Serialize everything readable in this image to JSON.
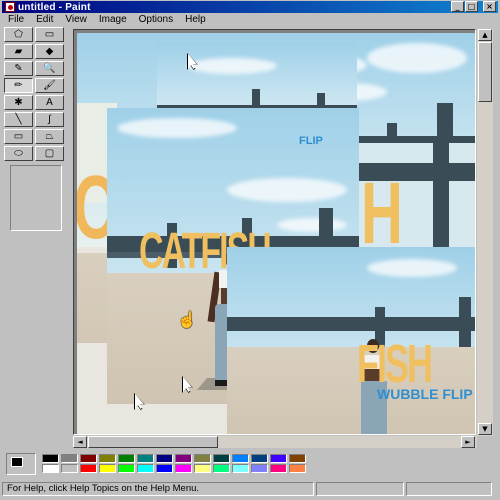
{
  "window": {
    "title": "untitled - Paint"
  },
  "title_buttons": {
    "minimize": "_",
    "maximize": "□",
    "close": "×"
  },
  "menu": {
    "items": [
      "File",
      "Edit",
      "View",
      "Image",
      "Options",
      "Help"
    ]
  },
  "toolbox": {
    "tools": [
      {
        "name": "free-form-select-icon",
        "glyph": "⬠"
      },
      {
        "name": "select-icon",
        "glyph": "▭"
      },
      {
        "name": "eraser-icon",
        "glyph": "▰"
      },
      {
        "name": "fill-icon",
        "glyph": "◆"
      },
      {
        "name": "pick-color-icon",
        "glyph": "✎"
      },
      {
        "name": "magnifier-icon",
        "glyph": "🔍"
      },
      {
        "name": "pencil-icon",
        "glyph": "✏"
      },
      {
        "name": "brush-icon",
        "glyph": "🖌"
      },
      {
        "name": "airbrush-icon",
        "glyph": "✱"
      },
      {
        "name": "text-icon",
        "glyph": "A"
      },
      {
        "name": "line-icon",
        "glyph": "╲"
      },
      {
        "name": "curve-icon",
        "glyph": "∫"
      },
      {
        "name": "rectangle-icon",
        "glyph": "▭"
      },
      {
        "name": "polygon-icon",
        "glyph": "⏢"
      },
      {
        "name": "ellipse-icon",
        "glyph": "⬭"
      },
      {
        "name": "rounded-rectangle-icon",
        "glyph": "▢"
      }
    ]
  },
  "canvas": {
    "title_text": "CATFISH",
    "title_fragment_1": "H",
    "title_fragment_2": "FISH",
    "title_fragment_3": "H",
    "subtitle": "WUBBLE FLIP",
    "subtitle_fragment": "FLIP"
  },
  "scroll": {
    "up": "▲",
    "down": "▼",
    "left": "◄",
    "right": "►"
  },
  "palette": {
    "colors": [
      "#000000",
      "#808080",
      "#800000",
      "#808000",
      "#008000",
      "#008080",
      "#000080",
      "#800080",
      "#808040",
      "#004040",
      "#0080ff",
      "#004080",
      "#4000ff",
      "#804000",
      "#ffffff",
      "#c0c0c0",
      "#ff0000",
      "#ffff00",
      "#00ff00",
      "#00ffff",
      "#0000ff",
      "#ff00ff",
      "#ffff80",
      "#00ff80",
      "#80ffff",
      "#8080ff",
      "#ff0080",
      "#ff8040"
    ],
    "foreground": "#000000",
    "background": "#ffffff"
  },
  "status": {
    "help_text": "For Help, click Help Topics on the Help Menu."
  }
}
